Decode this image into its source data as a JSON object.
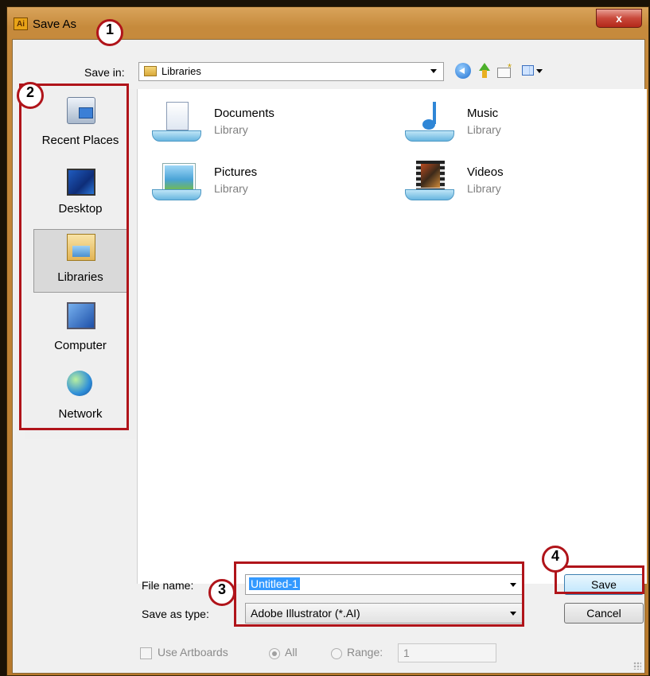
{
  "window": {
    "title": "Save As",
    "app_icon_text": "Ai",
    "close_glyph": "x",
    "close_icon": "close-icon"
  },
  "toolbar": {
    "save_in_label": "Save in:",
    "save_in_value": "Libraries",
    "icons": [
      "back-icon",
      "up-folder-icon",
      "new-folder-icon",
      "view-menu-icon"
    ]
  },
  "places": [
    {
      "label": "Recent Places",
      "icon": "recent-places-icon",
      "selected": false
    },
    {
      "label": "Desktop",
      "icon": "desktop-icon",
      "selected": false
    },
    {
      "label": "Libraries",
      "icon": "libraries-icon",
      "selected": true
    },
    {
      "label": "Computer",
      "icon": "computer-icon",
      "selected": false
    },
    {
      "label": "Network",
      "icon": "network-icon",
      "selected": false
    }
  ],
  "libraries": [
    {
      "name": "Documents",
      "type": "Library",
      "icon": "documents-library-icon"
    },
    {
      "name": "Music",
      "type": "Library",
      "icon": "music-library-icon"
    },
    {
      "name": "Pictures",
      "type": "Library",
      "icon": "pictures-library-icon"
    },
    {
      "name": "Videos",
      "type": "Library",
      "icon": "videos-library-icon"
    }
  ],
  "form": {
    "file_name_label": "File name:",
    "file_name_value": "Untitled-1",
    "save_type_label": "Save as type:",
    "save_type_value": "Adobe Illustrator (*.AI)"
  },
  "buttons": {
    "save": "Save",
    "cancel": "Cancel"
  },
  "options": {
    "use_artboards_label": "Use Artboards",
    "all_label": "All",
    "range_label": "Range:",
    "range_value": "1"
  },
  "callouts": [
    "1",
    "2",
    "3",
    "4"
  ],
  "colors": {
    "callout_red": "#b0141a",
    "selection_blue": "#3399ff",
    "window_frame": "#c68a3c"
  }
}
